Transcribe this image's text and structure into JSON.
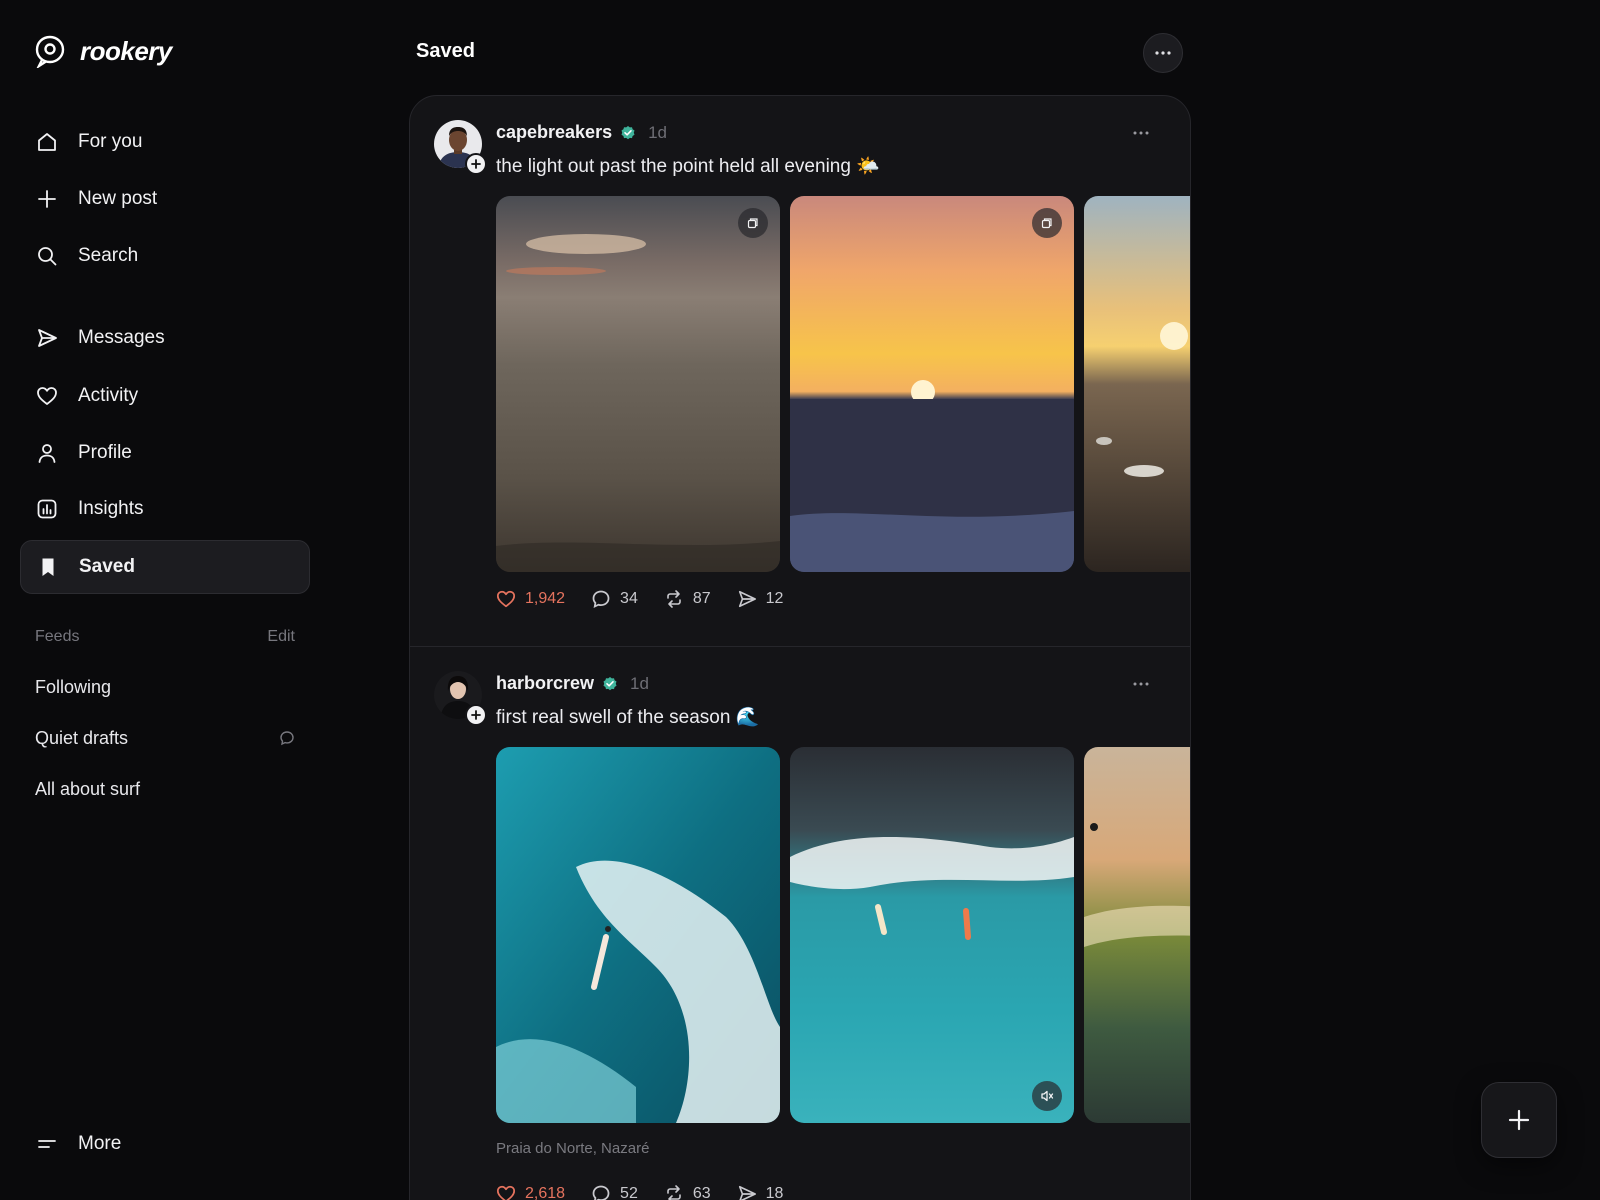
{
  "app": {
    "name": "rookery"
  },
  "sidebar": {
    "items": [
      {
        "label": "For you",
        "icon": "home-icon"
      },
      {
        "label": "New post",
        "icon": "plus-icon"
      },
      {
        "label": "Search",
        "icon": "search-icon"
      },
      {
        "label": "Messages",
        "icon": "send-icon"
      },
      {
        "label": "Activity",
        "icon": "heart-icon"
      },
      {
        "label": "Profile",
        "icon": "person-icon"
      },
      {
        "label": "Insights",
        "icon": "chart-icon"
      },
      {
        "label": "Saved",
        "icon": "bookmark-icon",
        "active": true
      }
    ],
    "feeds": {
      "title": "Feeds",
      "edit_label": "Edit",
      "items": [
        {
          "label": "Following"
        },
        {
          "label": "Quiet drafts",
          "icon": "comment-icon"
        },
        {
          "label": "All about surf"
        }
      ]
    },
    "more_label": "More"
  },
  "header": {
    "title": "Saved"
  },
  "posts": [
    {
      "username": "capebreakers",
      "verified": true,
      "time": "1d",
      "caption": "the light out past the point held all evening 🌤️",
      "media": [
        "overcast-sunset-sea",
        "orange-sunset-sea",
        "beach-sunset-rocks"
      ],
      "stats": {
        "likes": "1,942",
        "comments": "34",
        "reposts": "87",
        "shares": "12"
      }
    },
    {
      "username": "harborcrew",
      "verified": true,
      "time": "1d",
      "caption": "first real swell of the season 🌊",
      "media": [
        "aerial-surfer-wave",
        "two-surfers-wave",
        "surfer-green-wave"
      ],
      "location": "Praia do Norte, Nazaré",
      "stats": {
        "likes": "2,618",
        "comments": "52",
        "reposts": "63",
        "shares": "18"
      }
    }
  ],
  "colors": {
    "background": "#0a0a0c",
    "card": "#141417",
    "like": "#e5735e",
    "verified": "#3fb39b"
  }
}
